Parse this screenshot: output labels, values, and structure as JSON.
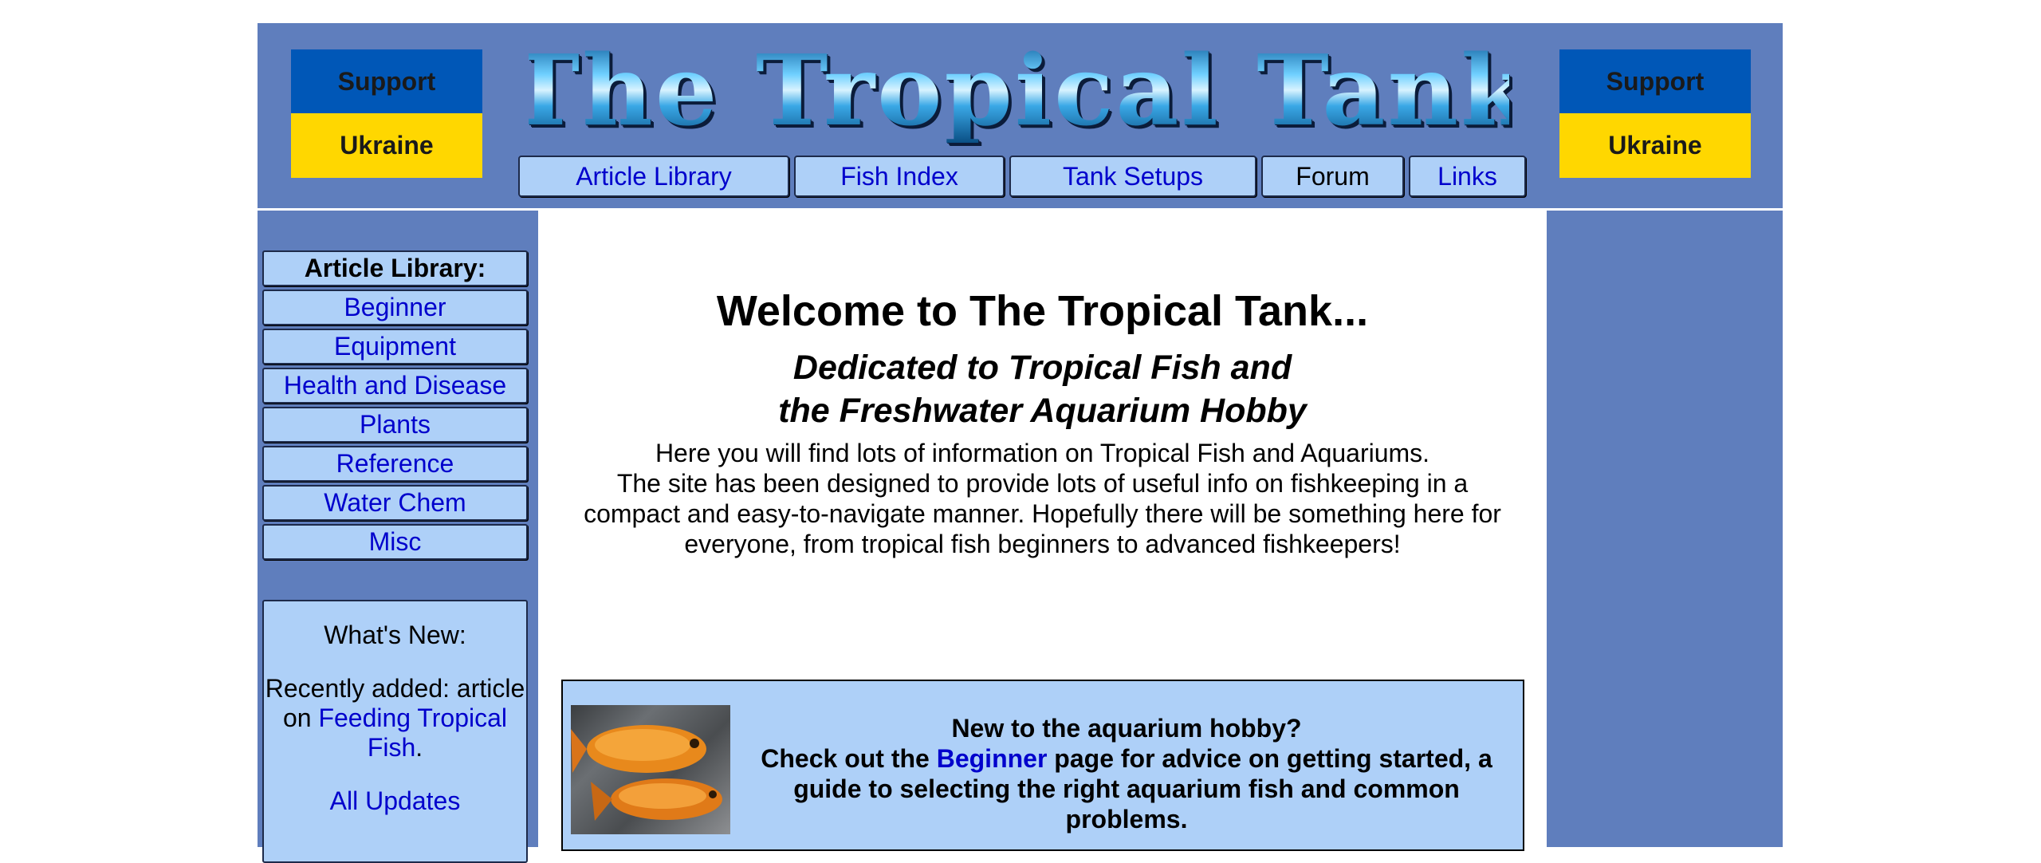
{
  "header": {
    "logo_text": "The Tropical Tank",
    "support_top": "Support",
    "support_bottom": "Ukraine"
  },
  "topnav": [
    {
      "label": "Article Library"
    },
    {
      "label": "Fish Index"
    },
    {
      "label": "Tank Setups"
    },
    {
      "label": "Forum"
    },
    {
      "label": "Links"
    }
  ],
  "sidebar": {
    "heading": "Article Library:",
    "items": [
      {
        "label": "Beginner"
      },
      {
        "label": "Equipment"
      },
      {
        "label": "Health and Disease"
      },
      {
        "label": "Plants"
      },
      {
        "label": "Reference"
      },
      {
        "label": "Water Chem"
      },
      {
        "label": "Misc"
      }
    ]
  },
  "news": {
    "title": "What's New:",
    "recent_prefix": "Recently added: article on",
    "recent_link": "Feeding Tropical Fish",
    "recent_suffix": ".",
    "all_updates": "All Updates"
  },
  "main": {
    "title": "Welcome to The Tropical Tank...",
    "tagline_1": "Dedicated to Tropical Fish and",
    "tagline_2": "the Freshwater Aquarium Hobby",
    "intro_1": "Here you will find lots of information on Tropical Fish and Aquariums.",
    "intro_2": "The site has been designed to provide lots of useful info on fishkeeping in a compact and easy-to-navigate manner. Hopefully there will be something here for everyone, from tropical fish beginners to advanced fishkeepers!",
    "promo": {
      "question": "New to the aquarium hobby?",
      "prefix": "Check out the",
      "link": "Beginner",
      "suffix": "page for advice on getting started, a guide to selecting the right aquarium fish and common problems."
    }
  },
  "colors": {
    "page_frame": "#5f7ebd",
    "button_bg": "#aed0f8",
    "link": "#0000cc",
    "ukraine_blue": "#0057b7",
    "ukraine_yellow": "#ffd700"
  }
}
